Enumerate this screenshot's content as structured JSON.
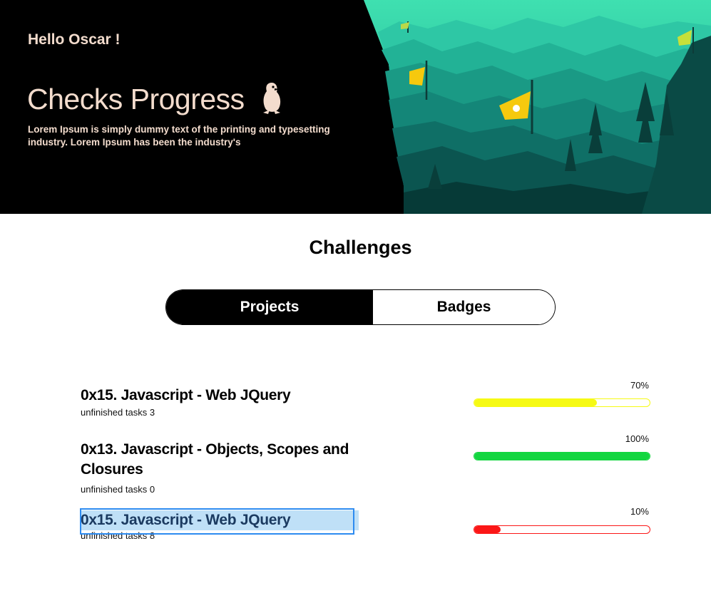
{
  "hero": {
    "greeting": "Hello Oscar !",
    "title": "Checks Progress",
    "description": "Lorem Ipsum is simply dummy text of the printing and typesetting industry. Lorem Ipsum has been the industry's"
  },
  "challenges": {
    "title": "Challenges",
    "tabs": [
      {
        "label": "Projects",
        "active": true
      },
      {
        "label": "Badges",
        "active": false
      }
    ]
  },
  "projects": [
    {
      "title": "0x15. Javascript - Web JQuery",
      "subtitle": "unfinished tasks 3",
      "percent_label": "70%",
      "progress": 0.7,
      "color": "#f6fa14"
    },
    {
      "title": "0x13. Javascript - Objects, Scopes and Closures",
      "subtitle": "unfinished tasks 0",
      "percent_label": "100%",
      "progress": 1.0,
      "color": "#13d640"
    },
    {
      "title": "0x15. Javascript - Web JQuery",
      "subtitle": "unfinished tasks 8",
      "percent_label": "10%",
      "progress": 0.15,
      "color": "#fb1717"
    }
  ],
  "colors": {
    "hero_text": "#f3dccd",
    "flag": "#f6c90e",
    "selection": "#2d8bf0"
  },
  "icons": {
    "mascot": "penguin-mascot-icon",
    "flag": "flag-icon"
  }
}
